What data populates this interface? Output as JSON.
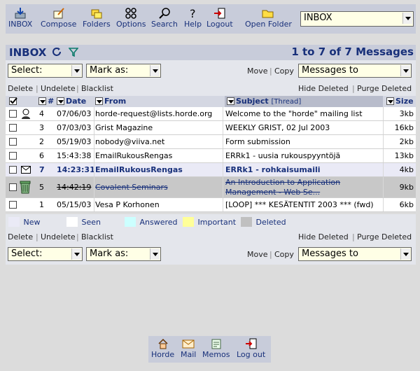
{
  "toolbar": {
    "inbox": "INBOX",
    "compose": "Compose",
    "folders": "Folders",
    "options": "Options",
    "search": "Search",
    "help": "Help",
    "logout": "Logout",
    "open_folder": "Open Folder",
    "folder_select": "INBOX"
  },
  "mailbox": {
    "title": "INBOX",
    "count": "1 to 7 of 7 Messages"
  },
  "controls_top": {
    "select": "Select:",
    "mark_as": "Mark as:",
    "move": "Move",
    "sep": "|",
    "copy": "Copy",
    "messages_to": "Messages to"
  },
  "actions": {
    "delete": "Delete",
    "undelete": "Undelete",
    "blacklist": "Blacklist",
    "hide_deleted": "Hide Deleted",
    "purge_deleted": "Purge Deleted",
    "sep": "|"
  },
  "columns": {
    "num": "#",
    "date": "Date",
    "from": "From",
    "subject": "Subject",
    "thread": "[Thread]",
    "size": "Size"
  },
  "messages": [
    {
      "num": "4",
      "date": "07/06/03",
      "from": "horde-request@lists.horde.org",
      "subject": "Welcome to the \"horde\" mailing list",
      "size": "3kb"
    },
    {
      "num": "3",
      "date": "07/03/03",
      "from": "Grist Magazine",
      "subject": "WEEKLY GRIST, 02 Jul 2003",
      "size": "16kb"
    },
    {
      "num": "2",
      "date": "05/19/03",
      "from": "nobody@viiva.net",
      "subject": "Form submission",
      "size": "2kb"
    },
    {
      "num": "6",
      "date": "15:43:38",
      "from": "EmailRukousRengas",
      "subject": "ERRk1 - uusia rukouspyyntöjä",
      "size": "13kb"
    },
    {
      "num": "7",
      "date": "14:23:31",
      "from": "EmailRukousRengas",
      "subject": "ERRk1 - rohkaisumaili",
      "size": "4kb"
    },
    {
      "num": "5",
      "date": "14:42:19",
      "from": "Covalent Seminars",
      "subject_line1": "An Introduction to Application",
      "subject_line2": "Management - Web Se...",
      "size": "9kb"
    },
    {
      "num": "1",
      "date": "05/15/03",
      "from": "Vesa P Korhonen",
      "subject": "[LOOP] *** KESÄTENTIT 2003 *** (fwd)",
      "size": "6kb"
    }
  ],
  "legend": {
    "new": "New",
    "seen": "Seen",
    "answered": "Answered",
    "important": "Important",
    "deleted": "Deleted"
  },
  "colors": {
    "new": "#eaeaf6",
    "seen": "#ffffff",
    "answered": "#ccffff",
    "important": "#ffff99",
    "deleted": "#c8c8c8",
    "link": "#18307a"
  },
  "footer": {
    "horde": "Horde",
    "mail": "Mail",
    "memos": "Memos",
    "logout": "Log out"
  }
}
